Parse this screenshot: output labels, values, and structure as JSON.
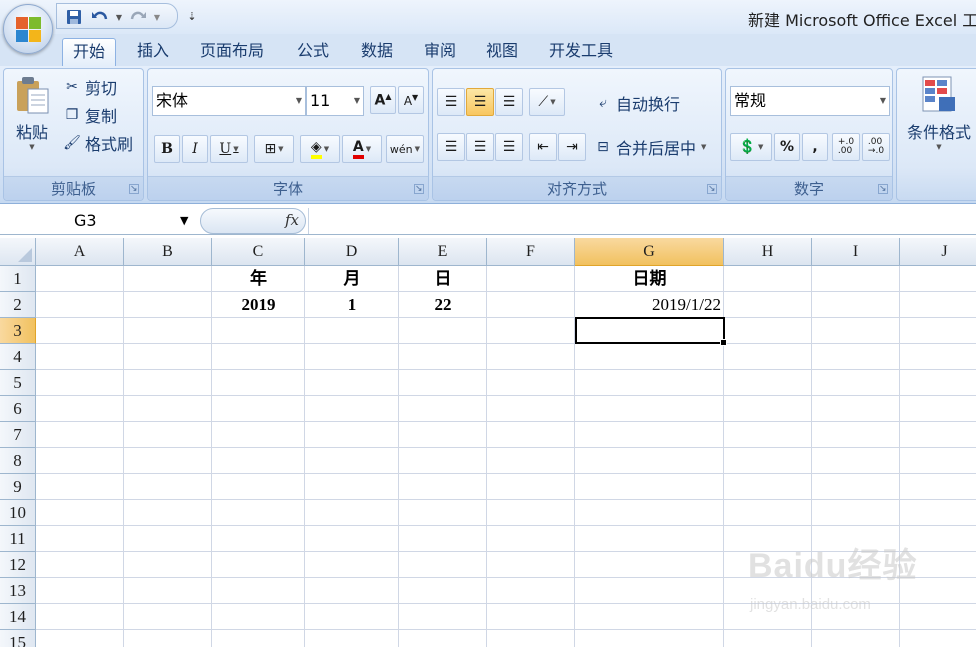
{
  "window": {
    "title": "新建 Microsoft Office Excel 工作表"
  },
  "qat": {
    "icons": [
      "save-icon",
      "undo-icon",
      "redo-icon",
      "customize-qat-icon"
    ]
  },
  "tabs": [
    "开始",
    "插入",
    "页面布局",
    "公式",
    "数据",
    "审阅",
    "视图",
    "开发工具"
  ],
  "ribbon": {
    "clipboard": {
      "paste": "粘贴",
      "cut": "剪切",
      "copy": "复制",
      "format_painter": "格式刷",
      "label": "剪贴板"
    },
    "font": {
      "name": "宋体",
      "size": "11",
      "label": "字体",
      "bold": "B",
      "italic": "I",
      "underline": "U"
    },
    "alignment": {
      "wrap": "自动换行",
      "merge": "合并后居中",
      "label": "对齐方式"
    },
    "number": {
      "format": "常规",
      "label": "数字",
      "percent": "%",
      "comma": ",",
      "inc_decimal": "←.0 .00",
      "dec_decimal": ".00 →.0"
    },
    "styles": {
      "conditional": "条件格式"
    }
  },
  "formula_bar": {
    "name_box": "G3",
    "fx": "fx",
    "content": ""
  },
  "sheet": {
    "columns": [
      "A",
      "B",
      "C",
      "D",
      "E",
      "F",
      "G",
      "H",
      "I",
      "J"
    ],
    "rows": [
      "1",
      "2",
      "3",
      "4",
      "5",
      "6",
      "7",
      "8",
      "9",
      "10",
      "11",
      "12",
      "13",
      "14",
      "15"
    ],
    "selected_cell": "G3",
    "cells": {
      "C1": "年",
      "D1": "月",
      "E1": "日",
      "G1": "日期",
      "C2": "2019",
      "D2": "1",
      "E2": "22",
      "G2": "2019/1/22"
    }
  },
  "watermark": {
    "brand": "Baidu经验",
    "site": "jingyan.baidu.com"
  }
}
